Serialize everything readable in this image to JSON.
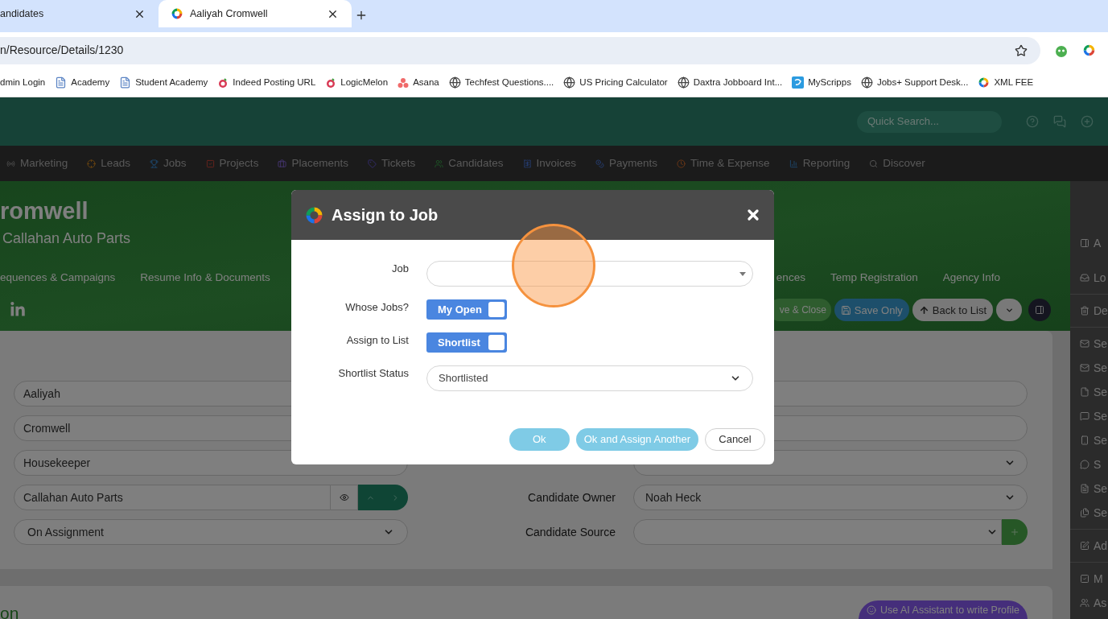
{
  "browser": {
    "tabs": [
      {
        "title": "andidates",
        "selected": false
      },
      {
        "title": "Aaliyah Cromwell",
        "selected": true
      }
    ],
    "address": "n/Resource/Details/1230",
    "bookmarks": [
      {
        "label": "dmin Login",
        "kind": "none"
      },
      {
        "label": "Academy",
        "kind": "doc"
      },
      {
        "label": "Student Academy",
        "kind": "doc"
      },
      {
        "label": "Indeed Posting URL",
        "kind": "melon"
      },
      {
        "label": "LogicMelon",
        "kind": "melon"
      },
      {
        "label": "Asana",
        "kind": "asana"
      },
      {
        "label": "Techfest Questions....",
        "kind": "globe"
      },
      {
        "label": "US Pricing Calculator",
        "kind": "globe"
      },
      {
        "label": "Daxtra Jobboard Int...",
        "kind": "globe"
      },
      {
        "label": "MyScripps",
        "kind": "scripps"
      },
      {
        "label": "Jobs+ Support Desk...",
        "kind": "globe"
      },
      {
        "label": "XML FEE",
        "kind": "logo"
      }
    ]
  },
  "app": {
    "search": {
      "placeholder": "Quick Search..."
    },
    "nav": [
      {
        "label": "Marketing",
        "kind": "radio"
      },
      {
        "label": "Leads",
        "kind": "target"
      },
      {
        "label": "Jobs",
        "kind": "trophy"
      },
      {
        "label": "Projects",
        "kind": "check"
      },
      {
        "label": "Placements",
        "kind": "briefcase"
      },
      {
        "label": "Tickets",
        "kind": "tag"
      },
      {
        "label": "Candidates",
        "kind": "users"
      },
      {
        "label": "Invoices",
        "kind": "receipt"
      },
      {
        "label": "Payments",
        "kind": "coins"
      },
      {
        "label": "Time & Expense",
        "kind": "clock"
      },
      {
        "label": "Reporting",
        "kind": "chart"
      },
      {
        "label": "Discover",
        "kind": "search"
      }
    ],
    "hero": {
      "name": "romwell",
      "company": "Callahan Auto Parts",
      "tabs_left": [
        "equences & Campaigns",
        "Resume Info & Documents"
      ],
      "tabs_right": [
        "ences",
        "Temp Registration",
        "Agency Info"
      ],
      "actions": [
        {
          "label": "ve & Close",
          "kind": "green"
        },
        {
          "label": "Save Only",
          "kind": "blue"
        },
        {
          "label": "Back to List",
          "kind": "light"
        },
        {
          "kind": "caret"
        },
        {
          "kind": "panel"
        }
      ]
    },
    "form": {
      "left": [
        {
          "value": "Aaliyah",
          "kind": "input"
        },
        {
          "value": "Cromwell",
          "kind": "input"
        },
        {
          "value": "Housekeeper",
          "kind": "input"
        },
        {
          "value": "Callahan Auto Parts",
          "kind": "company"
        },
        {
          "value": "On Assignment",
          "kind": "select"
        }
      ],
      "right": [
        {
          "kind": "input"
        },
        {
          "kind": "input"
        },
        {
          "kind": "select"
        },
        {
          "label": "Candidate Owner",
          "value": "Noah Heck",
          "kind": "select"
        },
        {
          "label": "Candidate Source",
          "kind": "select_add"
        }
      ]
    },
    "section": {
      "heading": "on",
      "ai_button": "Use AI Assistant to write Profile"
    },
    "sidebar": [
      [
        {
          "label": "A",
          "kind": "panel"
        }
      ],
      [
        {
          "label": "Lo",
          "kind": "inbox"
        }
      ],
      [
        {
          "label": "De",
          "kind": "trash"
        }
      ],
      [
        {
          "label": "Se",
          "kind": "mail"
        },
        {
          "label": "Se",
          "kind": "mail"
        },
        {
          "label": "Se",
          "kind": "file"
        },
        {
          "label": "Se",
          "kind": "chat"
        },
        {
          "label": "Se",
          "kind": "phone"
        },
        {
          "label": "S",
          "kind": "whatsapp"
        },
        {
          "label": "Se",
          "kind": "doc"
        },
        {
          "label": "Se",
          "kind": "files"
        }
      ],
      [
        {
          "label": "Ad",
          "kind": "edit"
        }
      ],
      [
        {
          "label": "M",
          "kind": "checkbox"
        },
        {
          "label": "As",
          "kind": "users"
        }
      ]
    ]
  },
  "dialog": {
    "title": "Assign to Job",
    "rows": [
      {
        "label": "Job",
        "kind": "combo"
      },
      {
        "label": "Whose Jobs?",
        "kind": "toggle",
        "text": "My Open",
        "on": true
      },
      {
        "label": "Assign to List",
        "kind": "toggle",
        "text": "Shortlist",
        "on": true
      },
      {
        "label": "Shortlist Status",
        "kind": "select",
        "value": "Shortlisted"
      }
    ],
    "buttons": [
      {
        "label": "Ok",
        "kind": "primary",
        "disabled": true
      },
      {
        "label": "Ok and Assign Another",
        "kind": "primary",
        "disabled": true
      },
      {
        "label": "Cancel",
        "kind": "secondary",
        "disabled": false
      }
    ]
  }
}
